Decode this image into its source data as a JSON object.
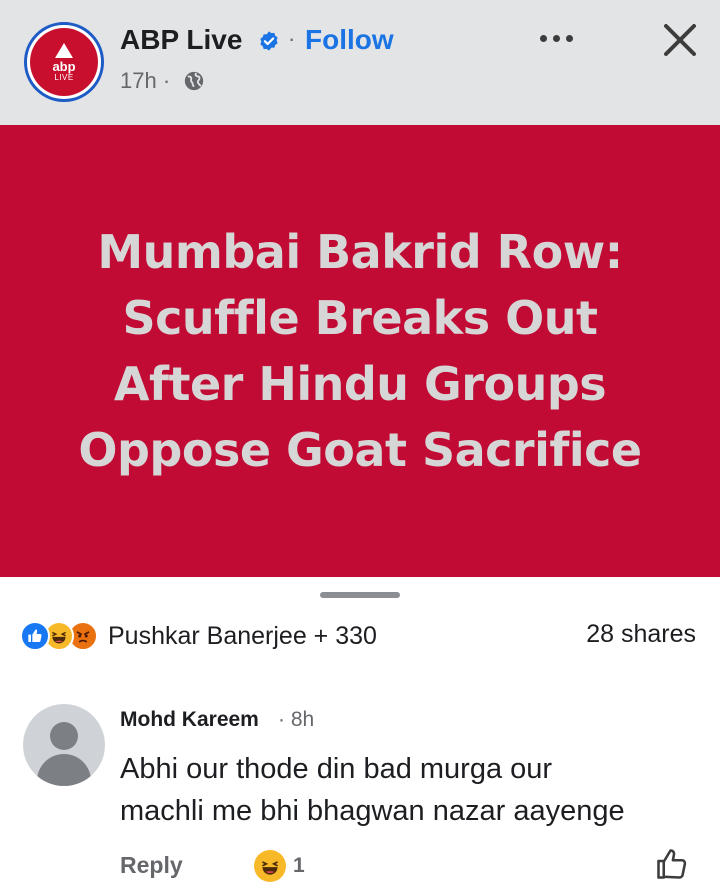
{
  "header": {
    "logo_text": "abp",
    "logo_sub": "LIVE",
    "page_name": "ABP Live",
    "separator": "·",
    "follow_label": "Follow",
    "timestamp": "17h ·",
    "icons": {
      "verified": "verified-badge-icon",
      "audience": "globe-icon",
      "more": "more-options-icon",
      "close": "close-icon"
    }
  },
  "post": {
    "headline_lines": [
      "Mumbai Bakrid Row:",
      "Scuffle Breaks Out",
      "After Hindu Groups",
      "Oppose Goat Sacrifice"
    ],
    "banner_color": "#c10a34"
  },
  "engagement": {
    "reactions": [
      "like",
      "haha",
      "angry"
    ],
    "reactors_text": "Pushkar Banerjee + 330",
    "shares_text": "28 shares"
  },
  "comment": {
    "author": "Mohd Kareem",
    "time": "· 8h",
    "text_lines": [
      "Abhi our thode din bad murga our",
      "machli me bhi bhagwan nazar aayenge"
    ],
    "reply_label": "Reply",
    "reaction": "haha",
    "reaction_count": "1"
  },
  "colors": {
    "accent": "#1b74e4",
    "like": "#1877f2",
    "haha": "#f7b928",
    "angry": "#e9710f"
  }
}
